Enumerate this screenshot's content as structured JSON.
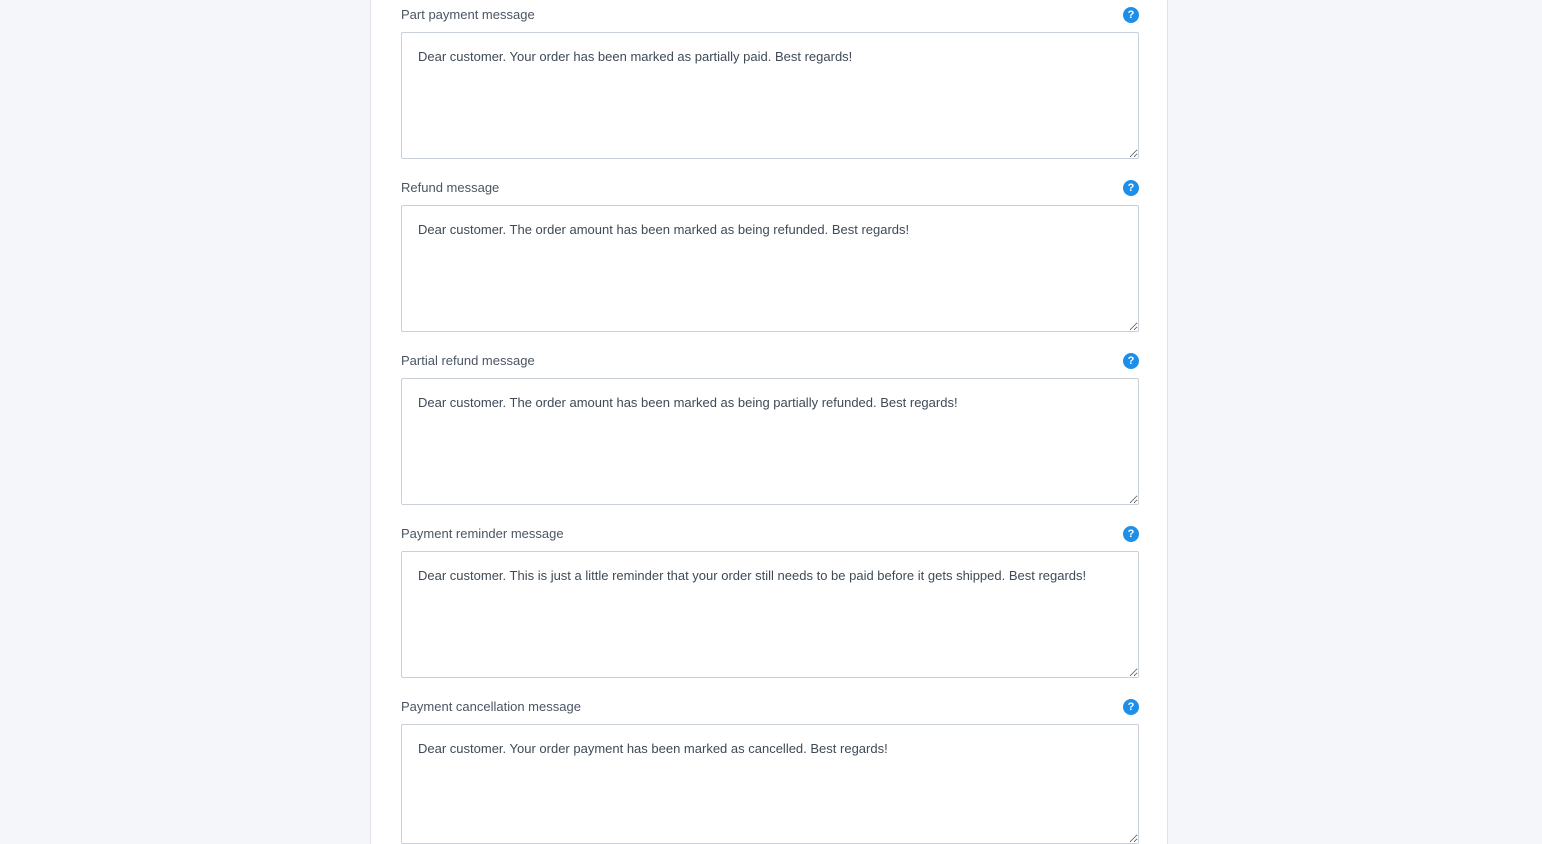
{
  "fields": [
    {
      "label": "Part payment message",
      "help_icon": "question-circle-icon",
      "value": "Dear customer. Your order has been marked as partially paid. Best regards!"
    },
    {
      "label": "Refund message",
      "help_icon": "question-circle-icon",
      "value": "Dear customer. The order amount has been marked as being refunded. Best regards!"
    },
    {
      "label": "Partial refund message",
      "help_icon": "question-circle-icon",
      "value": "Dear customer. The order amount has been marked as being partially refunded. Best regards!"
    },
    {
      "label": "Payment reminder message",
      "help_icon": "question-circle-icon",
      "value": "Dear customer. This is just a little reminder that your order still needs to be paid before it gets shipped. Best regards!"
    },
    {
      "label": "Payment cancellation message",
      "help_icon": "question-circle-icon",
      "value": "Dear customer. Your order payment has been marked as cancelled. Best regards!"
    }
  ],
  "colors": {
    "accent": "#1e8fe8",
    "background": "#f4f6f9",
    "panel": "#ffffff"
  }
}
